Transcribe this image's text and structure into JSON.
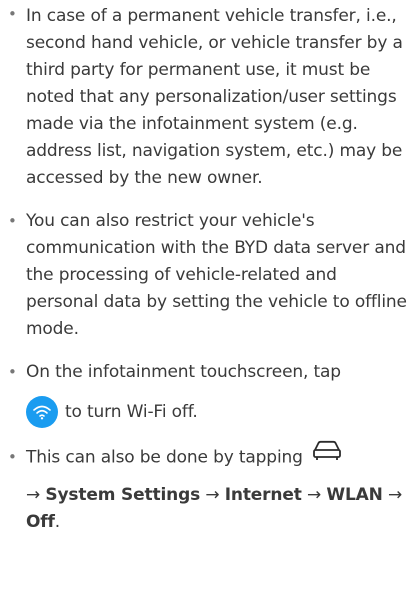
{
  "bullets": [
    {
      "text": "In case of a permanent vehicle transfer, i.e., second hand vehicle, or vehicle transfer by a third party for permanent use, it must be noted that any personalization/user settings made via the infotainment system (e.g. address list, navigation system, etc.) may be accessed by the new owner."
    },
    {
      "text": "You can also restrict your vehicle's communication with the BYD data server and the processing of vehicle-related and personal data by setting the vehicle to offline mode."
    },
    {
      "line1": "On the infotainment touchscreen, tap",
      "line2": "to turn Wi-Fi off.",
      "icon": "wifi-icon",
      "icon_color": "#1a9cf0"
    },
    {
      "line1": "This can also be done by tapping",
      "icon": "car-icon",
      "path": [
        {
          "sep": "→ ",
          "label": "System Settings"
        },
        {
          "sep": " → ",
          "label": "Internet"
        },
        {
          "sep": " → ",
          "label": "WLAN"
        },
        {
          "sep": " → ",
          "label": "Off"
        }
      ],
      "end": "."
    }
  ],
  "bullet_symbol": "•"
}
